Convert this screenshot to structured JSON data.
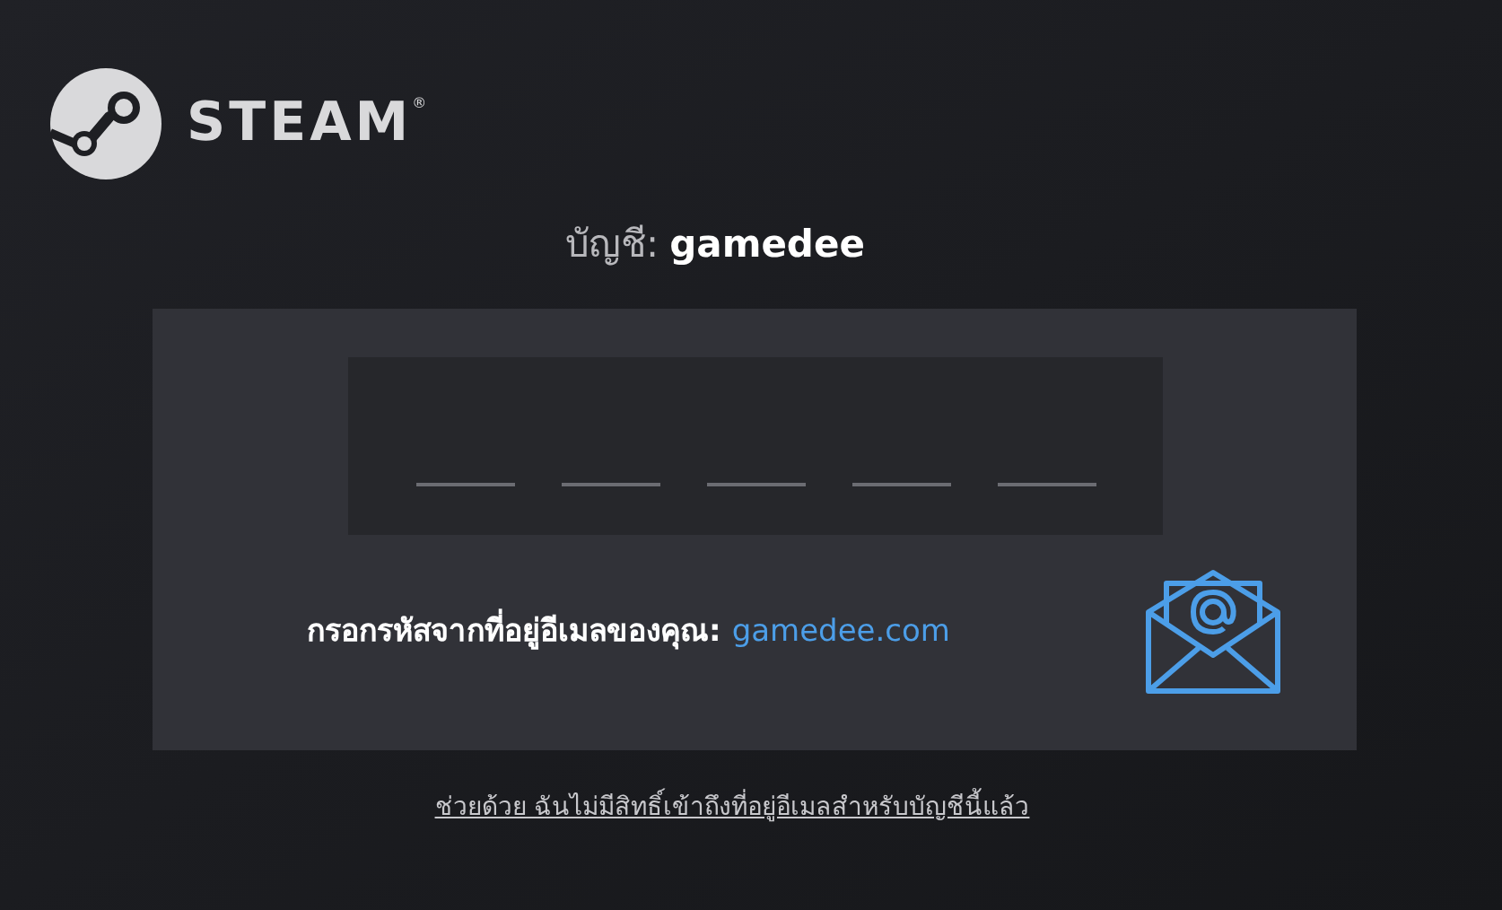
{
  "logo": {
    "wordmark": "STEAM",
    "registered": "®"
  },
  "account": {
    "label": "บัญชี:",
    "name": "gamedee"
  },
  "code_prompt": {
    "text": "กรอกรหัสจากที่อยู่อีเมลของคุณ:",
    "domain": "gamedee.com"
  },
  "help_link": "ช่วยด้วย ฉันไม่มีสิทธิ์เข้าถึงที่อยู่อีเมลสำหรับบัญชีนี้แล้ว"
}
